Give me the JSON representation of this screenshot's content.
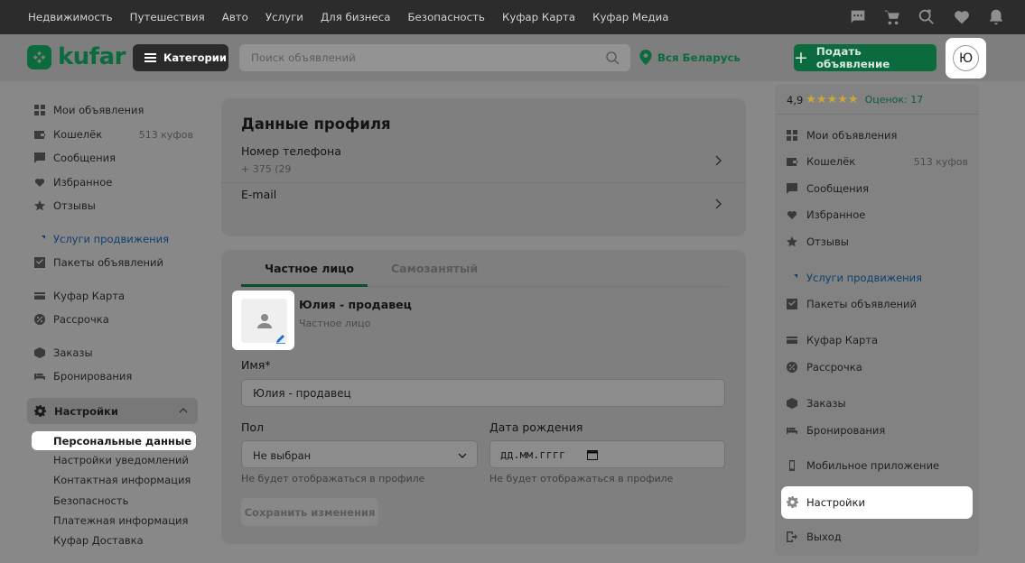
{
  "topnav": [
    "Недвижимость",
    "Путешествия",
    "Авто",
    "Услуги",
    "Для бизнеса",
    "Безопасность",
    "Куфар Карта",
    "Куфар Медиа"
  ],
  "header": {
    "logo_text": "kufar",
    "categories_label": "Категории",
    "search_placeholder": "Поиск объявлений",
    "region": "Вся Беларусь",
    "post_label": "Подать объявление",
    "avatar_letter": "Ю"
  },
  "sidebar": {
    "items": [
      {
        "label": "Мои объявления",
        "icon": "grid-icon"
      },
      {
        "label": "Кошелёк",
        "extra": "513 куфов",
        "icon": "wallet-icon"
      },
      {
        "label": "Сообщения",
        "icon": "chat-icon"
      },
      {
        "label": "Избранное",
        "icon": "heart-icon"
      },
      {
        "label": "Отзывы",
        "icon": "star-icon"
      },
      {
        "label": "Услуги продвижения",
        "icon": "trend-icon"
      },
      {
        "label": "Пакеты объявлений",
        "icon": "package-icon"
      },
      {
        "label": "Куфар Карта",
        "icon": "card-icon"
      },
      {
        "label": "Рассрочка",
        "icon": "installment-icon"
      },
      {
        "label": "Заказы",
        "icon": "box-icon"
      },
      {
        "label": "Бронирования",
        "icon": "bed-icon"
      }
    ],
    "settings_label": "Настройки",
    "settings_sub": [
      "Персональные данные",
      "Настройки уведомлений",
      "Контактная информация",
      "Безопасность",
      "Платежная информация",
      "Куфар Доставка"
    ]
  },
  "profile": {
    "title": "Данные профиля",
    "phone_label": "Номер телефона",
    "phone_value": "+ 375 (29",
    "email_label": "E-mail"
  },
  "form": {
    "tabs": [
      "Частное лицо",
      "Самозанятый"
    ],
    "user_name": "Юлия - продавец",
    "user_type": "Частное лицо",
    "name_label": "Имя*",
    "name_value": "Юлия - продавец",
    "gender_label": "Пол",
    "gender_value": "Не выбран",
    "birth_label": "Дата рождения",
    "birth_placeholder": "дд.мм.гггг",
    "hint": "Не будет отображаться в профиле",
    "save_label": "Сохранить изменения"
  },
  "dropdown": {
    "rating": "4,9",
    "stars": "★★★★★",
    "reviews": "Оценок: 17",
    "items": [
      {
        "label": "Мои объявления",
        "icon": "grid-icon"
      },
      {
        "label": "Кошелёк",
        "extra": "513 куфов",
        "icon": "wallet-icon"
      },
      {
        "label": "Сообщения",
        "icon": "chat-icon"
      },
      {
        "label": "Избранное",
        "icon": "heart-icon"
      },
      {
        "label": "Отзывы",
        "icon": "star-icon"
      },
      {
        "label": "Услуги продвижения",
        "icon": "trend-icon"
      },
      {
        "label": "Пакеты объявлений",
        "icon": "package-icon"
      },
      {
        "label": "Куфар Карта",
        "icon": "card-icon"
      },
      {
        "label": "Рассрочка",
        "icon": "installment-icon"
      },
      {
        "label": "Заказы",
        "icon": "box-icon"
      },
      {
        "label": "Бронирования",
        "icon": "bed-icon"
      },
      {
        "label": "Мобильное приложение",
        "icon": "phone-icon"
      },
      {
        "label": "Настройки",
        "icon": "gear-icon"
      },
      {
        "label": "Выход",
        "icon": "logout-icon"
      }
    ]
  },
  "colors": {
    "brand": "#0b6b3c",
    "link": "#0f3f6f",
    "stars": "#c9a73a"
  }
}
